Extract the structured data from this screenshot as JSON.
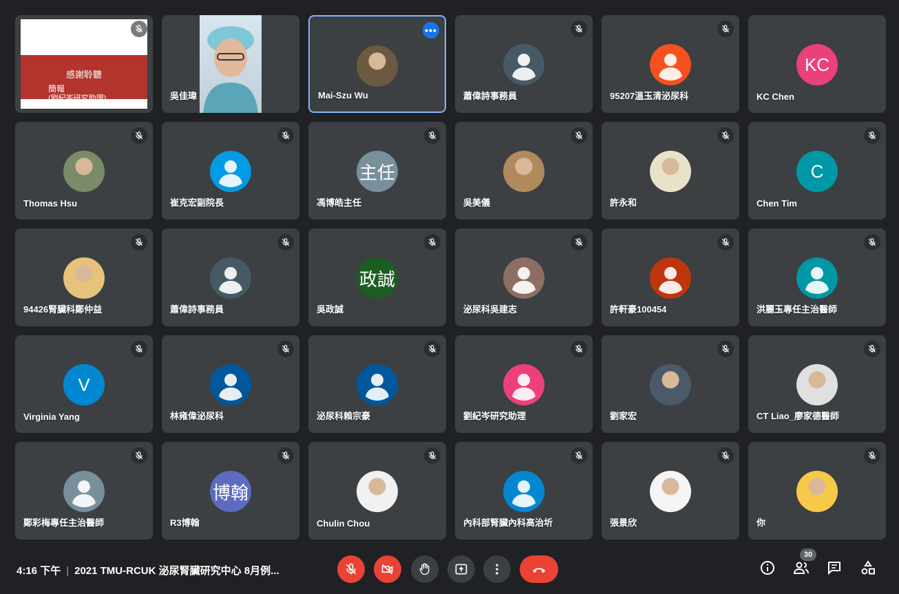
{
  "participants": [
    {
      "name": "",
      "avatar_type": "slide",
      "muted": true,
      "slide": {
        "title": "感謝聆聽",
        "sub1": "簡報",
        "sub2": "(劉紀岑研究助理)"
      }
    },
    {
      "name": "吳佳瑋",
      "avatar_type": "video",
      "muted": false
    },
    {
      "name": "Mai-Szu Wu",
      "avatar_type": "photo",
      "photo_color": "#6b5a3f",
      "speaking": true,
      "more_options": "•••"
    },
    {
      "name": "蕭偉詩事務員",
      "avatar_type": "default",
      "color": "#455a64",
      "muted": true
    },
    {
      "name": "95207溫玉清泌尿科",
      "avatar_type": "default",
      "color": "#f4511e",
      "muted": true
    },
    {
      "name": "KC Chen",
      "avatar_type": "initials",
      "initials": "KC",
      "color": "#ec407a"
    },
    {
      "name": "Thomas Hsu",
      "avatar_type": "photo",
      "photo_color": "#7a8b6a",
      "muted": true
    },
    {
      "name": "崔克宏副院長",
      "avatar_type": "default",
      "color": "#039be5",
      "muted": true
    },
    {
      "name": "馮博皓主任",
      "avatar_type": "initials",
      "initials": "主任",
      "color": "#78909c",
      "muted": true
    },
    {
      "name": "吳美儀",
      "avatar_type": "photo",
      "photo_color": "#b08a5c",
      "muted": true
    },
    {
      "name": "許永和",
      "avatar_type": "photo",
      "photo_color": "#e8e2c8",
      "muted": true
    },
    {
      "name": "Chen Tim",
      "avatar_type": "initials",
      "initials": "C",
      "color": "#0097a7",
      "muted": true
    },
    {
      "name": "94426腎臟科鄭仲益",
      "avatar_type": "photo",
      "photo_color": "#e6c27a",
      "muted": true
    },
    {
      "name": "蕭偉詩事務員",
      "avatar_type": "default",
      "color": "#455a64",
      "muted": true
    },
    {
      "name": "吳政誠",
      "avatar_type": "initials",
      "initials": "政誠",
      "color": "#1b5e20",
      "muted": true
    },
    {
      "name": "泌尿科吳建志",
      "avatar_type": "default",
      "color": "#8d6e63",
      "muted": true
    },
    {
      "name": "許軒豪100454",
      "avatar_type": "default",
      "color": "#bf360c",
      "muted": true
    },
    {
      "name": "洪麗玉專任主治醫師",
      "avatar_type": "default",
      "color": "#0097a7",
      "muted": true
    },
    {
      "name": "Virginia Yang",
      "avatar_type": "initials",
      "initials": "V",
      "color": "#0288d1",
      "muted": true
    },
    {
      "name": "林雍偉泌尿科",
      "avatar_type": "default",
      "color": "#01579b",
      "muted": true
    },
    {
      "name": "泌尿科賴宗豪",
      "avatar_type": "default",
      "color": "#01579b",
      "muted": true
    },
    {
      "name": "劉紀岑研究助理",
      "avatar_type": "default",
      "color": "#ec407a",
      "muted": true
    },
    {
      "name": "劉家宏",
      "avatar_type": "photo",
      "photo_color": "#4a5a6a",
      "muted": true
    },
    {
      "name": "CT Liao_廖家德醫師",
      "avatar_type": "photo",
      "photo_color": "#e0e0e0",
      "muted": true
    },
    {
      "name": "鄭彩梅專任主治醫師",
      "avatar_type": "default",
      "color": "#78909c",
      "muted": true
    },
    {
      "name": "R3博翰",
      "avatar_type": "initials",
      "initials": "博翰",
      "color": "#5c6bc0",
      "muted": true
    },
    {
      "name": "Chulin Chou",
      "avatar_type": "photo",
      "photo_color": "#f1f1f1",
      "muted": true
    },
    {
      "name": "內科部腎臟內科高治圻",
      "avatar_type": "default",
      "color": "#0288d1",
      "muted": true
    },
    {
      "name": "張景欣",
      "avatar_type": "photo",
      "photo_color": "#f5f5f5",
      "muted": true
    },
    {
      "name": "你",
      "avatar_type": "photo",
      "photo_color": "#f7c948",
      "muted": true
    }
  ],
  "bottom_bar": {
    "time": "4:16 下午",
    "separator": "|",
    "meeting_title": "2021 TMU-RCUK 泌尿腎臟研究中心 8月例...",
    "participant_count": "30",
    "controls": [
      "mic-off-icon",
      "camera-off-icon",
      "raise-hand-icon",
      "present-screen-icon",
      "more-options-icon",
      "end-call-icon"
    ],
    "right_controls": [
      "info-icon",
      "people-icon",
      "chat-icon",
      "activities-icon"
    ]
  },
  "colors": {
    "background": "#202124",
    "tile": "#3c4043",
    "danger": "#ea4335",
    "active_border": "#8ab4f8"
  }
}
